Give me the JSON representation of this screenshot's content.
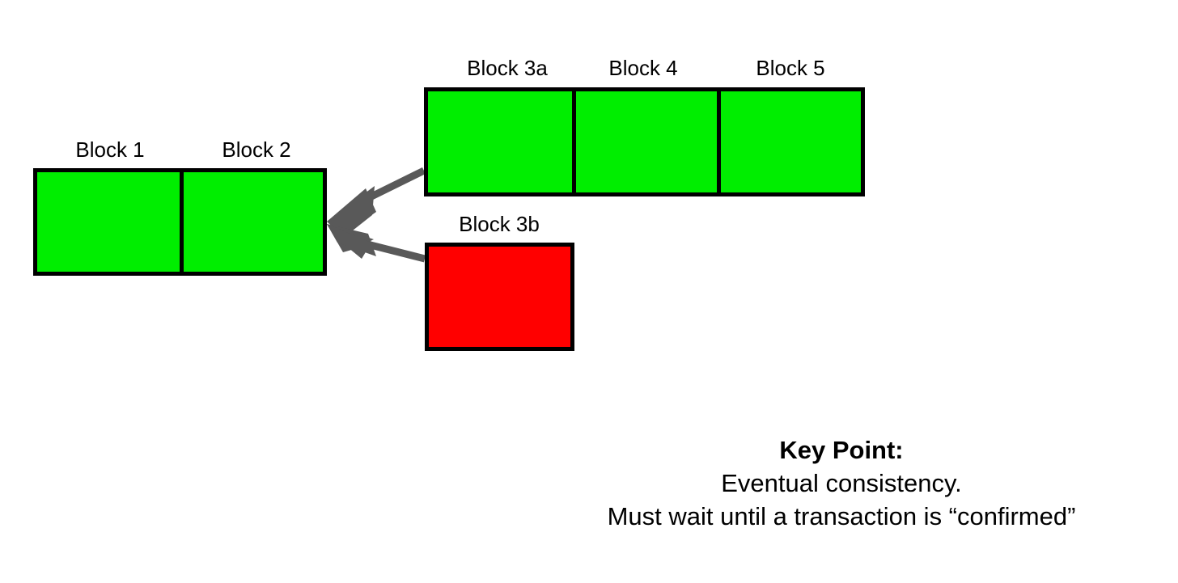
{
  "diagram": {
    "type": "blockchain-fork",
    "background_color": "#ffffff",
    "colors": {
      "confirmed_block": "#00ee00",
      "orphaned_block": "#ff0000",
      "block_border": "#000000",
      "arrow": "#595959",
      "text": "#000000"
    },
    "main_chain": {
      "name": "main-chain",
      "blocks": [
        {
          "label": "Block 1",
          "status": "confirmed",
          "color": "#00ee00"
        },
        {
          "label": "Block 2",
          "status": "confirmed",
          "color": "#00ee00"
        }
      ]
    },
    "fork_a": {
      "name": "winning-fork",
      "blocks": [
        {
          "label": "Block 3a",
          "status": "confirmed",
          "color": "#00ee00"
        },
        {
          "label": "Block 4",
          "status": "confirmed",
          "color": "#00ee00"
        },
        {
          "label": "Block 5",
          "status": "confirmed",
          "color": "#00ee00"
        }
      ]
    },
    "fork_b": {
      "name": "orphaned-fork",
      "blocks": [
        {
          "label": "Block 3b",
          "status": "orphaned",
          "color": "#ff0000"
        }
      ]
    },
    "arrows": [
      {
        "name": "arrow-fork-a-to-main",
        "from": "Block 3a",
        "to": "Block 2",
        "color": "#595959"
      },
      {
        "name": "arrow-fork-b-to-main",
        "from": "Block 3b",
        "to": "Block 2",
        "color": "#595959"
      }
    ]
  },
  "key_point": {
    "heading": "Key Point:",
    "lines": [
      "Eventual consistency.",
      "Must wait until a transaction is “confirmed”"
    ]
  }
}
